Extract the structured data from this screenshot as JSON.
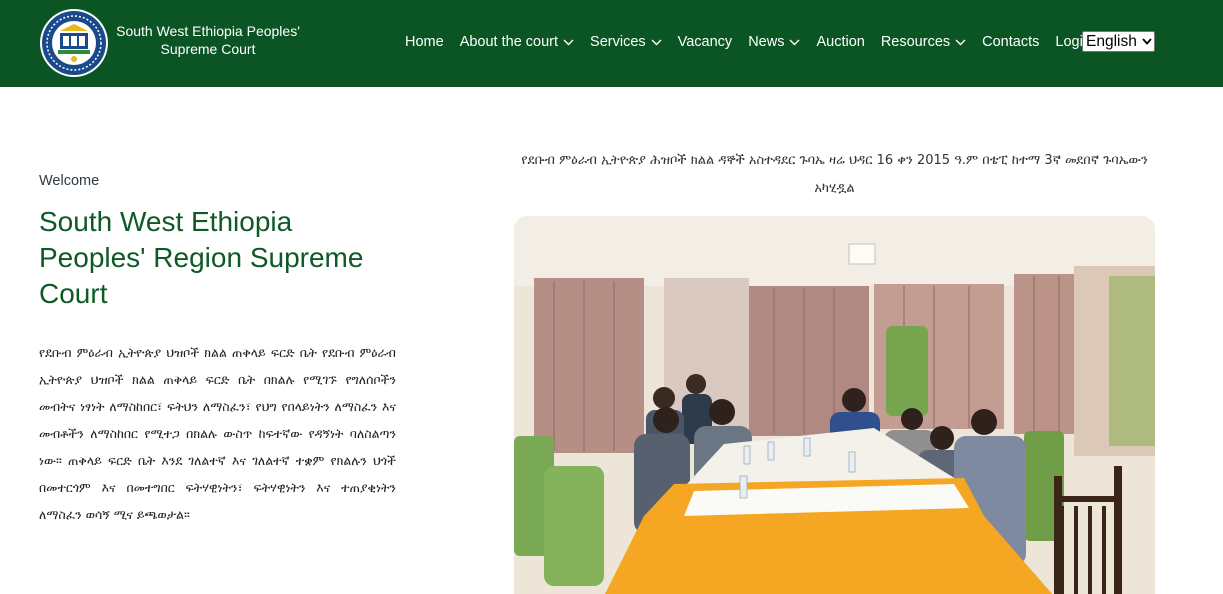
{
  "header": {
    "brand_line1": "South West Ethiopia Peoples'",
    "brand_line2": "Supreme Court",
    "logo_icon": "court-emblem-icon",
    "background_color": "#0b5524"
  },
  "nav": {
    "items": [
      {
        "label": "Home",
        "has_dropdown": false
      },
      {
        "label": "About the court",
        "has_dropdown": true
      },
      {
        "label": "Services",
        "has_dropdown": true
      },
      {
        "label": "Vacancy",
        "has_dropdown": false
      },
      {
        "label": "News",
        "has_dropdown": true
      },
      {
        "label": "Auction",
        "has_dropdown": false
      },
      {
        "label": "Resources",
        "has_dropdown": true
      },
      {
        "label": "Contacts",
        "has_dropdown": false
      },
      {
        "label": "Login",
        "has_dropdown": false
      }
    ],
    "language": {
      "selected": "English"
    }
  },
  "main": {
    "welcome": "Welcome",
    "title": "South West Ethiopia Peoples' Region Supreme Court",
    "intro": "የደቡብ ምዕራብ ኢትዮጵያ ህዝቦች ክልል ጠቅላይ ፍርድ ቤት የደቡብ ምዕራብ ኢትዮጵያ ህዝቦች ክልል ጠቅላይ ፍርድ ቤት በክልሉ የሚገኙ የግለሰቦችን መብትና ነፃነት ለማስከበር፣ ፍትህን ለማስፈን፣ የህግ የበላይነትን ለማስፈን እና መብቶችን ለማስከበር የሚተጋ በክልሉ ውስጥ ከፍተኛው የዳኝነት ባለስልጣን ነው። ጠቅላይ ፍርድ ቤት እንደ ገለልተኛ እና ገለልተኛ ተቋም የክልሉን ህጎች በመተርጎም እና በመተግበር ፍትሃዊነትን፣ ፍትሃዊነትን እና ተጠያቂነትን ለማስፈን ወሳኝ ሚና ይጫወታል።",
    "news_caption": "የደቡብ ምዕራብ ኢትዮጵያ ሕዝቦች ክልል ዳኞች አስተዳደር ጉባኤ ዛሬ ህዳር 16 ቀን 2015 ዓ.ም በቴፒ ከተማ 3ኛ መደበኛ ጉባኤውን አካሂዷል",
    "accent_color": "#0d5a26"
  }
}
